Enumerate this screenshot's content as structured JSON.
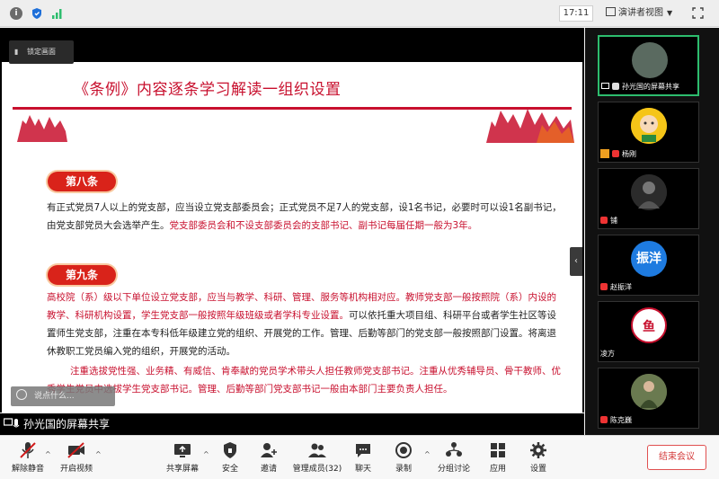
{
  "titlebar": {
    "time": "17:11",
    "view_mode": "演讲者视图",
    "icons": [
      "info-icon",
      "shield-icon",
      "signal-icon",
      "fullscreen-icon"
    ]
  },
  "share": {
    "lock_tip": "锁定画面",
    "slide_title": "《条例》内容逐条学习解读一组织设置",
    "article8_label": "第八条",
    "article8_text_a": "有正式党员7人以上的党支部，应当设立党支部委员会；正式党员不足7人的党支部，设1名书记，必要时可以设1名副书记，由党支部党员大会选举产生。",
    "article8_text_b": "党支部委员会和不设支部委员会的支部书记、副书记每届任期一般为3年。",
    "article9_label": "第九条",
    "article9_text_a": "高校院（系）级以下单位设立党支部，应当与教学、科研、管理、服务等机构相对应。教师党支部一般按照院（系）内设的教学、科研机构设置，学生党支部一般按照年级班级或者学科专业设置。",
    "article9_text_b": "可以依托重大项目组、科研平台或者学生社区等设置师生党支部，注重在本专科低年级建立党的组织、开展党的工作。管理、后勤等部门的党支部一般按照部门设置。将离退休教职工党员编入党的组织，开展党的活动。",
    "article9_text_c": "注重选拔党性强、业务精、有威信、肯奉献的党员学术带头人担任教师党支部书记。注重从优秀辅导员、骨干教师、优秀学生党员中选拔学生党支部书记。管理、后勤等部门党支部书记一般由本部门主要负责人担任。",
    "chat_tip": "说点什么...",
    "sharer_label": "孙光国的屏幕共享"
  },
  "participants": [
    {
      "name": "孙光国的屏幕共享",
      "avatar_text": "",
      "avatar_color": "#5a6a60",
      "active": true
    },
    {
      "name": "杨刚",
      "avatar_text": "",
      "avatar_color": "#f5c518",
      "active": false
    },
    {
      "name": "铺",
      "avatar_text": "",
      "avatar_color": "#2b2b2b",
      "active": false
    },
    {
      "name": "赵振洋",
      "avatar_text": "振洋",
      "avatar_color": "#1e7be0",
      "active": false
    },
    {
      "name": "凌方",
      "avatar_text": "鱼",
      "avatar_color": "#ffffff",
      "active": false
    },
    {
      "name": "陈克巍",
      "avatar_text": "",
      "avatar_color": "#6a7a50",
      "active": false
    }
  ],
  "toolbar": {
    "unmute": "解除静音",
    "start_video": "开启视频",
    "share_screen": "共享屏幕",
    "security": "安全",
    "invite": "邀请",
    "members": "管理成员(32)",
    "chat": "聊天",
    "record": "录制",
    "breakout": "分组讨论",
    "apps": "应用",
    "settings": "设置",
    "end_meeting": "结束会议"
  }
}
